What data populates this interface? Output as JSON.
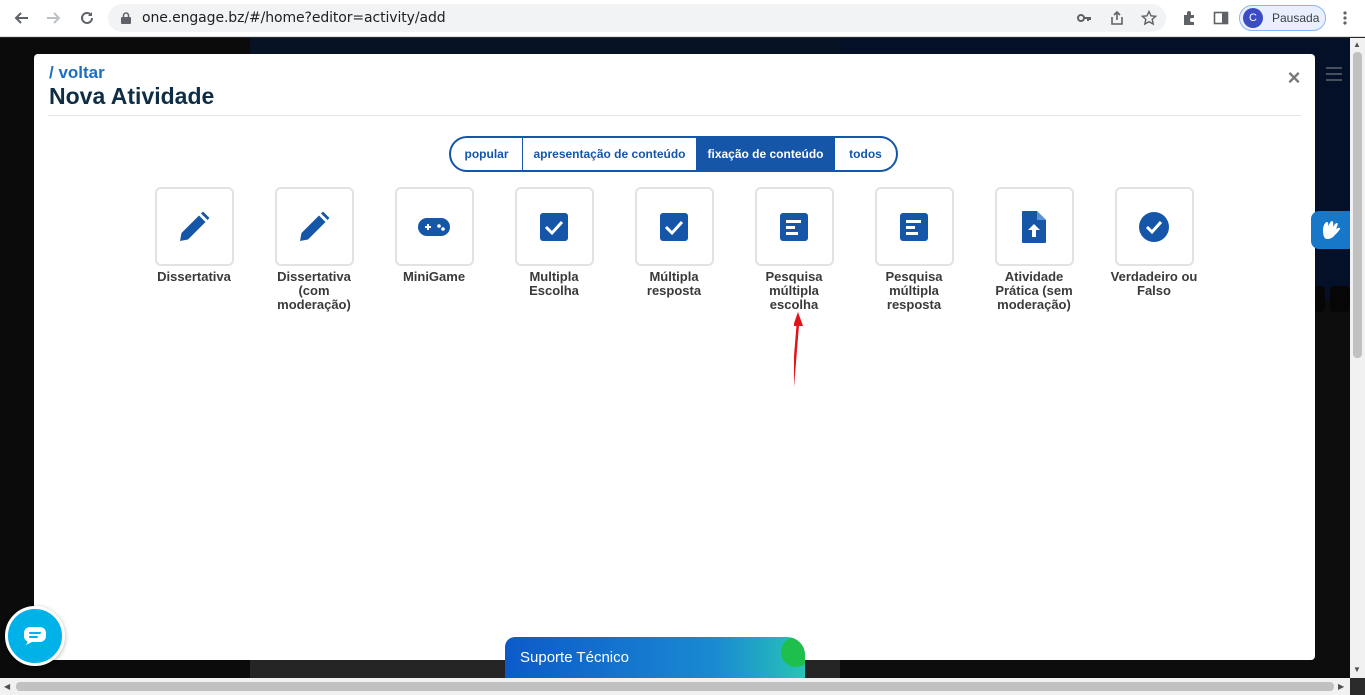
{
  "browser": {
    "url": "one.engage.bz/#/home?editor=activity/add",
    "profile_initial": "C",
    "profile_label": "Pausada"
  },
  "modal": {
    "back_label": "/ voltar",
    "title": "Nova Atividade",
    "close_label": "×",
    "tabs": [
      {
        "label": "popular",
        "active": false
      },
      {
        "label": "apresentação de conteúdo",
        "active": false
      },
      {
        "label": "fixação de conteúdo",
        "active": true
      },
      {
        "label": "todos",
        "active": false
      }
    ],
    "activities": [
      {
        "label": "Dissertativa",
        "icon": "pencil-icon"
      },
      {
        "label": "Dissertativa (com moderação)",
        "icon": "pencil-icon"
      },
      {
        "label": "MiniGame",
        "icon": "gamepad-icon"
      },
      {
        "label": "Multipla Escolha",
        "icon": "checkbox-icon"
      },
      {
        "label": "Múltipla resposta",
        "icon": "checkbox-icon"
      },
      {
        "label": "Pesquisa múltipla escolha",
        "icon": "poll-icon"
      },
      {
        "label": "Pesquisa múltipla resposta",
        "icon": "poll-icon"
      },
      {
        "label": "Atividade Prática (sem moderação)",
        "icon": "file-upload-icon"
      },
      {
        "label": "Verdadeiro ou Falso",
        "icon": "check-circle-icon"
      }
    ]
  },
  "support": {
    "label": "Suporte Técnico"
  },
  "colors": {
    "primary": "#1656a9",
    "title": "#0f2e46",
    "annotation": "#e0141b"
  }
}
